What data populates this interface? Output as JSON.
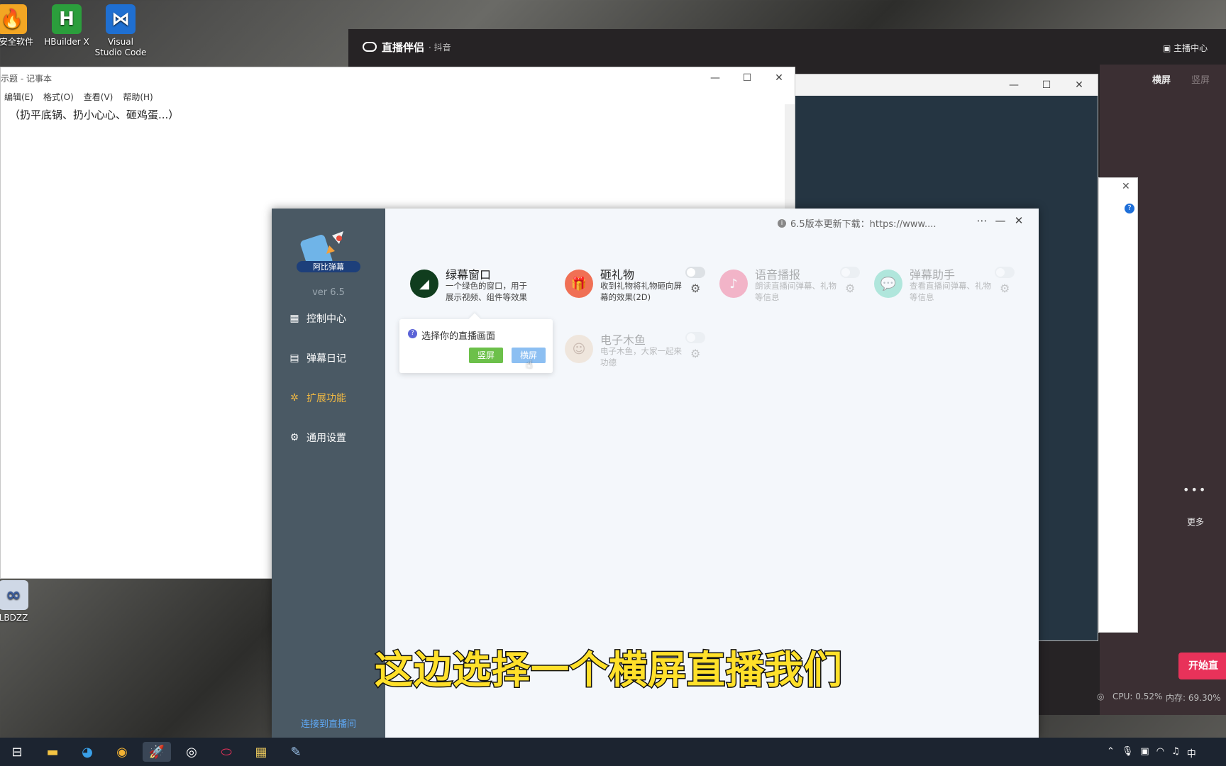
{
  "desktop": {
    "icons": [
      {
        "label": "拢安全软件",
        "color": "#f3a623",
        "glyph": "🔥"
      },
      {
        "label": "HBuilder X",
        "color": "#2b9e3c",
        "glyph": "H"
      },
      {
        "label": "Visual Studio Code",
        "color": "#1f6fd1",
        "glyph": "⋈"
      },
      {
        "label": "LBDZZ",
        "color": "#cfd8e6",
        "glyph": "∞"
      }
    ]
  },
  "douyin": {
    "brand": "直播伴侣",
    "brand_sub": "· 抖音",
    "anchor_center": "主播中心",
    "tab_landscape": "横屏",
    "tab_portrait": "竖屏",
    "more_label": "更多",
    "more_dots": "•••",
    "start_button": "开始直",
    "cpu": "CPU: 0.52%",
    "memory": "内存: 69.30%"
  },
  "notepad": {
    "title": "示题 - 记事本",
    "menu": [
      "编辑(E)",
      "格式(O)",
      "查看(V)",
      "帮助(H)"
    ],
    "content": "（扔平底锅、扔小心心、砸鸡蛋...）"
  },
  "app": {
    "version": "ver 6.5",
    "update_notice": "6.5版本更新下载：https://www....",
    "nav": [
      {
        "label": "控制中心",
        "icon": "▦"
      },
      {
        "label": "弹幕日记",
        "icon": "▤"
      },
      {
        "label": "扩展功能",
        "icon": "✲"
      },
      {
        "label": "通用设置",
        "icon": "⚙"
      }
    ],
    "connect_label": "连接到直播间",
    "cards": [
      {
        "title": "绿幕窗口",
        "desc": "一个绿色的窗口，用于展示视频、组件等效果",
        "color": "#103d1e",
        "glyph": "◢"
      },
      {
        "title": "砸礼物",
        "desc": "收到礼物将礼物砸向屏幕的效果(2D)",
        "color": "#f07055",
        "glyph": "🎁"
      },
      {
        "title": "语音播报",
        "desc": "朗读直播间弹幕、礼物等信息",
        "color": "#ef3a6b",
        "glyph": "♪"
      },
      {
        "title": "弹幕助手",
        "desc": "查看直播间弹幕、礼物等信息",
        "color": "#34c8a3",
        "glyph": "💬"
      },
      {
        "title": "电子木鱼",
        "desc": "电子木鱼，大家一起来功德",
        "color": "#e8c9a8",
        "glyph": "☺"
      }
    ],
    "tooltip": {
      "message": "选择你的直播画面",
      "portrait_btn": "竖屏",
      "landscape_btn": "横屏"
    }
  },
  "subtitle": "这边选择一个横屏直播我们",
  "colors": {
    "sidebar": "#4a5964",
    "accent_active": "#f0b843",
    "portrait_btn": "#6cc04a",
    "landscape_btn": "#8cbff2",
    "douyin_start": "#e8325a"
  }
}
